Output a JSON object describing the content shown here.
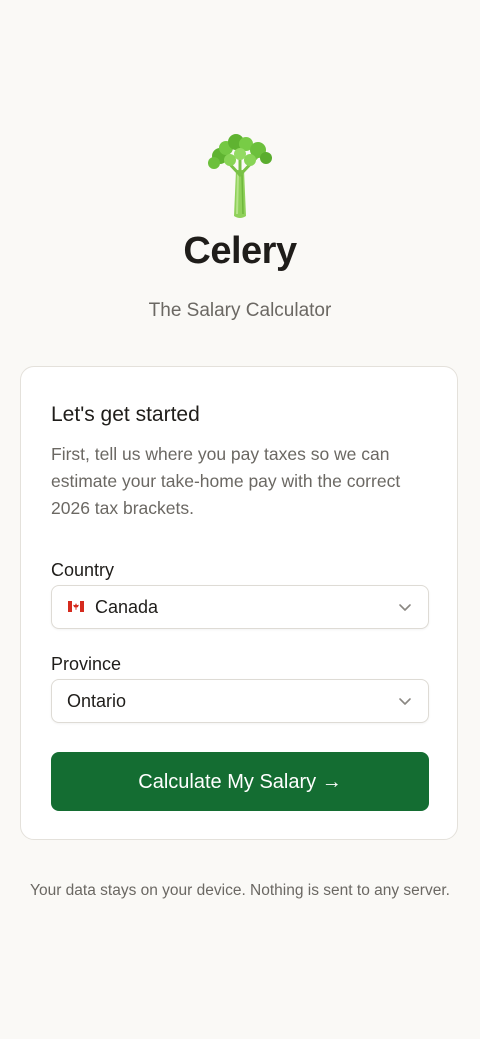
{
  "app": {
    "name": "Celery",
    "tagline": "The Salary Calculator",
    "logo_icon": "celery-icon"
  },
  "card": {
    "title": "Let's get started",
    "description": "First, tell us where you pay taxes so we can estimate your take-home pay with the correct 2026 tax brackets."
  },
  "country": {
    "label": "Country",
    "value": "Canada",
    "flag_icon": "canada-flag-icon"
  },
  "province": {
    "label": "Province",
    "value": "Ontario"
  },
  "cta": {
    "label": "Calculate My Salary →"
  },
  "footer": {
    "note": "Your data stays on your device. Nothing is sent to any server."
  },
  "colors": {
    "background": "#faf9f6",
    "primary_button": "#146d32",
    "celery_green": "#7cc444",
    "text_muted": "#6b6863"
  }
}
